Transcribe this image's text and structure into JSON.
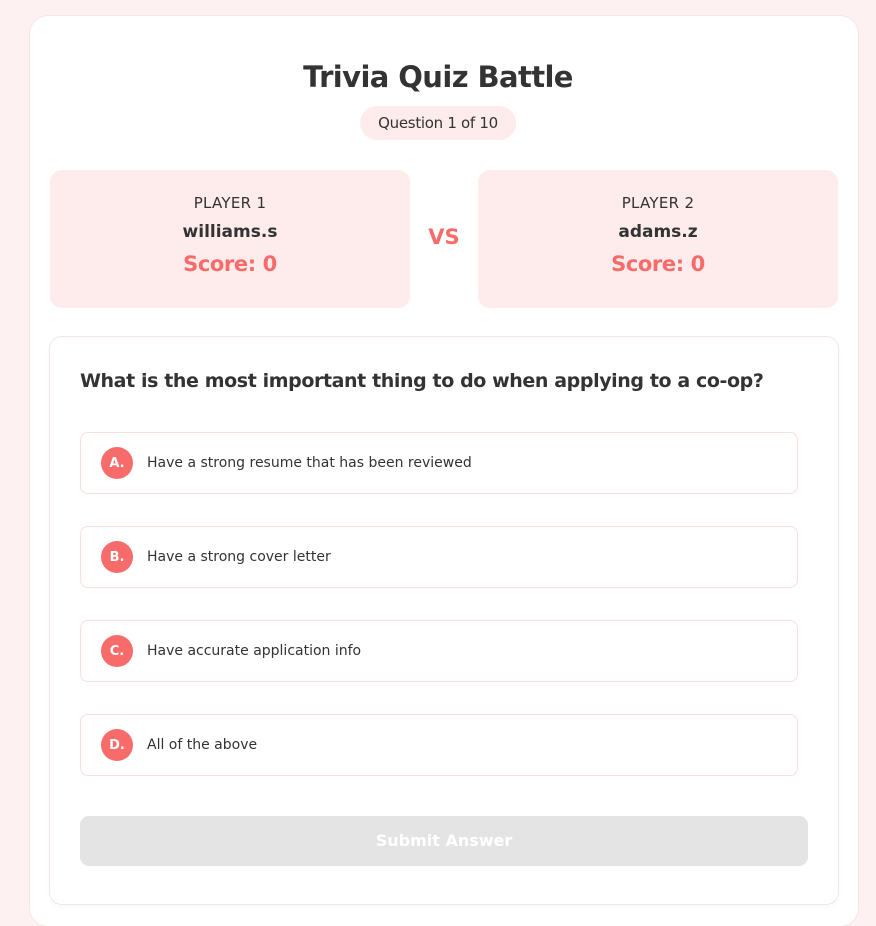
{
  "app": {
    "title": "Trivia Quiz Battle",
    "question_counter": "Question 1 of 10"
  },
  "players": [
    {
      "label": "PLAYER 1",
      "name": "williams.s",
      "score": "Score: 0"
    },
    {
      "label": "PLAYER 2",
      "name": "adams.z",
      "score": "Score: 0"
    }
  ],
  "vs_label": "VS",
  "question": {
    "text": "What is the most important thing to do when applying to a co-op?",
    "options": [
      {
        "letter": "A.",
        "text": "Have a strong resume that has been reviewed"
      },
      {
        "letter": "B.",
        "text": "Have a strong cover letter"
      },
      {
        "letter": "C.",
        "text": "Have accurate application info"
      },
      {
        "letter": "D.",
        "text": "All of the above"
      }
    ]
  },
  "submit": {
    "label": "Submit Answer",
    "state": "disabled"
  },
  "colors": {
    "accent": "#f76c6a",
    "panel_tint": "#fdeceb",
    "page_background": "#fdf2f1",
    "disabled_button": "#e4e4e4"
  }
}
